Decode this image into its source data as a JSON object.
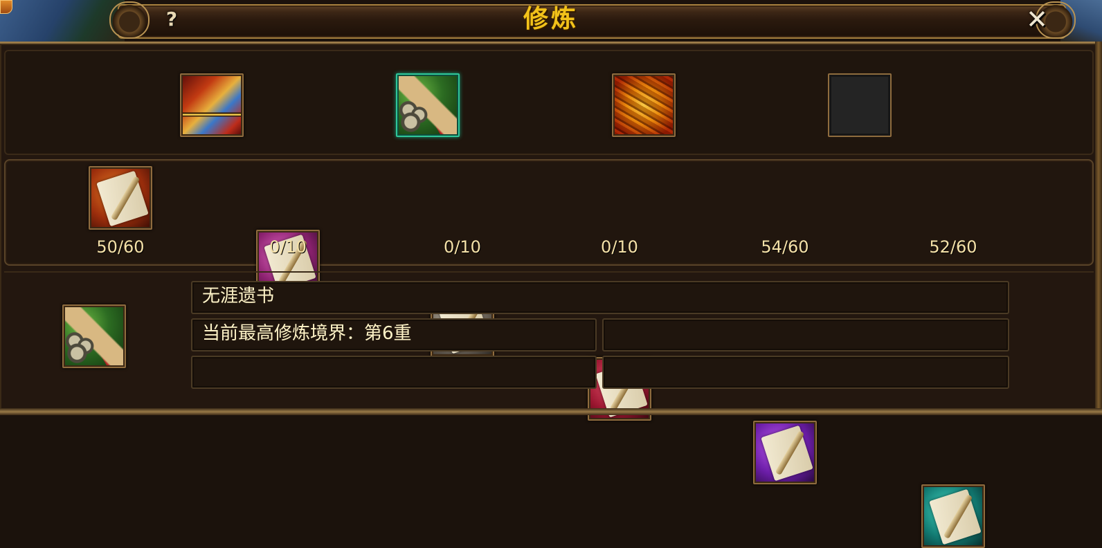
{
  "window": {
    "title": "修炼",
    "help_label": "?",
    "close_label": "✕"
  },
  "icons": {
    "help": "question-mark-icon",
    "close": "close-x-icon"
  },
  "technique_slots": [
    {
      "name": "golden-book",
      "state": "filled"
    },
    {
      "name": "green-scroll-bundle",
      "state": "selected"
    },
    {
      "name": "gold-scroll-bundle",
      "state": "filled"
    },
    {
      "name": "empty",
      "state": "empty"
    }
  ],
  "scrolls": [
    {
      "color": "orange",
      "count": "50/60"
    },
    {
      "color": "pink",
      "count": "0/10"
    },
    {
      "color": "gray",
      "count": "0/10"
    },
    {
      "color": "red",
      "count": "0/10"
    },
    {
      "color": "purple",
      "count": "54/60"
    },
    {
      "color": "teal",
      "count": "52/60"
    }
  ],
  "details": {
    "name": "无涯遗书",
    "realm": "当前最高修炼境界：第6重",
    "row2_right": "",
    "row3_left": "",
    "row3_right": ""
  },
  "colors": {
    "title": "#f2c21a",
    "count_text": "#f5e1a8",
    "selected_border": "#2fc79a",
    "frame": "#8f6c3e"
  }
}
